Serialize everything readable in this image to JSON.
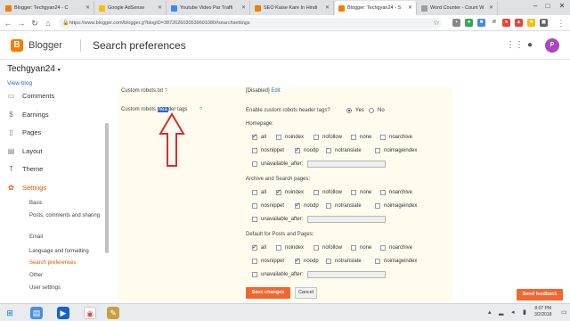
{
  "browser": {
    "tabs": [
      {
        "title": "Blogger: Techgyan24 - C",
        "favicon_color": "#f57d00",
        "active": false
      },
      {
        "title": "Google AdSense",
        "favicon_color": "#fbbc04",
        "active": false
      },
      {
        "title": "Youtube Video Par Traffi",
        "favicon_color": "#4285f4",
        "active": false
      },
      {
        "title": "SEO Kaise Kare In Hindi",
        "favicon_color": "#f57d00",
        "active": false
      },
      {
        "title": "Blogger: Techgyan24 - S",
        "favicon_color": "#f57d00",
        "active": true
      },
      {
        "title": "Word Counter - Count W",
        "favicon_color": "#9e9e9e",
        "active": false
      }
    ],
    "url": "https://www.blogger.com/blogger.g?blogID=3872626030539601080#searchsettings"
  },
  "app": {
    "brand": "Blogger",
    "page_title": "Search preferences",
    "blog_name": "Techgyan24",
    "view_blog": "View blog"
  },
  "sidebar": {
    "items": [
      {
        "label": "Comments",
        "icon": "comments-icon",
        "glyph": "▭"
      },
      {
        "label": "Earnings",
        "icon": "dollar-icon",
        "glyph": "$"
      },
      {
        "label": "Pages",
        "icon": "pages-icon",
        "glyph": "▯"
      },
      {
        "label": "Layout",
        "icon": "layout-icon",
        "glyph": "▤"
      },
      {
        "label": "Theme",
        "icon": "theme-icon",
        "glyph": "T"
      },
      {
        "label": "Settings",
        "icon": "gear-icon",
        "glyph": "✿"
      }
    ],
    "subitems": [
      {
        "label": "Basic"
      },
      {
        "label": "Posts, comments and sharing"
      },
      {
        "label": "Email"
      },
      {
        "label": "Language and formatting"
      },
      {
        "label": "Search preferences"
      },
      {
        "label": "Other"
      },
      {
        "label": "User settings"
      }
    ]
  },
  "settings": {
    "robots_txt_label": "Custom robots.txt",
    "robots_txt_value": "[Disabled]",
    "robots_txt_edit": "Edit",
    "header_tags_label_pre": "Custom robots ",
    "header_tags_label_sel": "hea",
    "header_tags_label_post": "der tags",
    "help": "?",
    "enable_question": "Enable custom robots header tags?",
    "yes": "Yes",
    "no": "No",
    "groups": [
      {
        "title": "Homepage:",
        "row1": [
          {
            "label": "all",
            "checked": true
          },
          {
            "label": "noindex",
            "checked": false
          },
          {
            "label": "nofollow",
            "checked": false
          },
          {
            "label": "none",
            "checked": false
          },
          {
            "label": "noarchive",
            "checked": false
          }
        ],
        "row2": [
          {
            "label": "nosnippet",
            "checked": false
          },
          {
            "label": "noodp",
            "checked": true
          },
          {
            "label": "notranslate",
            "checked": false
          },
          {
            "label": "noimageindex",
            "checked": false
          }
        ],
        "unavailable": "unavailable_after:"
      },
      {
        "title": "Archive and Search pages:",
        "row1": [
          {
            "label": "all",
            "checked": false
          },
          {
            "label": "noindex",
            "checked": true
          },
          {
            "label": "nofollow",
            "checked": false
          },
          {
            "label": "none",
            "checked": false
          },
          {
            "label": "noarchive",
            "checked": false
          }
        ],
        "row2": [
          {
            "label": "nosnippet",
            "checked": false
          },
          {
            "label": "noodp",
            "checked": true
          },
          {
            "label": "notranslate",
            "checked": false
          },
          {
            "label": "noimageindex",
            "checked": false
          }
        ],
        "unavailable": "unavailable_after:"
      },
      {
        "title": "Default for Posts and Pages:",
        "row1": [
          {
            "label": "all",
            "checked": true
          },
          {
            "label": "noindex",
            "checked": false
          },
          {
            "label": "nofollow",
            "checked": false
          },
          {
            "label": "none",
            "checked": false
          },
          {
            "label": "noarchive",
            "checked": false
          }
        ],
        "row2": [
          {
            "label": "nosnippet",
            "checked": false
          },
          {
            "label": "noodp",
            "checked": true
          },
          {
            "label": "notranslate",
            "checked": false
          },
          {
            "label": "noimageindex",
            "checked": false
          }
        ],
        "unavailable": "unavailable_after:"
      }
    ],
    "save_label": "Save changes",
    "cancel_label": "Cancel"
  },
  "feedback_label": "Send feedback",
  "taskbar": {
    "time": "8:07 PM",
    "date": "3/2/2018"
  },
  "colors": {
    "accent": "#f4662f",
    "panel_bg": "#fffbee",
    "arrow": "#d32f2f"
  }
}
